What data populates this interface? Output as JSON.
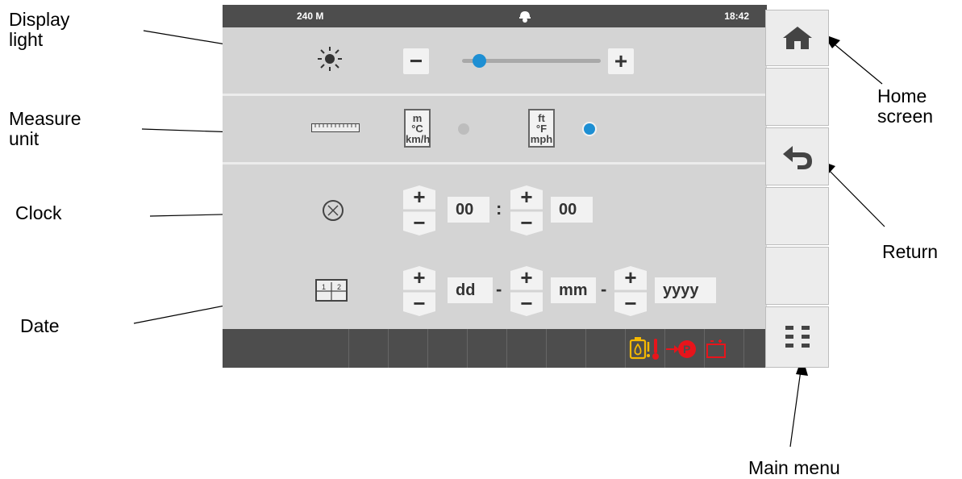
{
  "callouts": {
    "display_light": "Display\nlight",
    "measure_unit": "Measure\nunit",
    "clock": "Clock",
    "date": "Date",
    "home_screen": "Home\nscreen",
    "return": "Return",
    "main_menu": "Main menu"
  },
  "status": {
    "model": "240 M",
    "time": "18:42"
  },
  "display_light": {
    "minus": "−",
    "plus": "+",
    "brightness_fraction": 0.12
  },
  "measure_unit": {
    "metric": [
      "m",
      "°C",
      "km/h"
    ],
    "imperial": [
      "ft",
      "°F",
      "mph"
    ],
    "selected": "imperial"
  },
  "clock": {
    "hours": "00",
    "minutes": "00",
    "separator": ":",
    "plus": "+",
    "minus": "−"
  },
  "date": {
    "day": "dd",
    "month": "mm",
    "year": "yyyy",
    "separator": "-",
    "plus": "+",
    "minus": "−"
  },
  "colors": {
    "accent": "#1e8fd3",
    "warning_yellow": "#f5b800",
    "warning_red": "#e8141b"
  },
  "icons": [
    "sun-icon",
    "ruler-icon",
    "clock-icon",
    "calendar-icon",
    "helmet-icon",
    "home-icon",
    "return-icon",
    "menu-grid-icon",
    "engine-oil-icon",
    "coolant-temp-icon",
    "parking-brake-icon",
    "battery-icon"
  ]
}
